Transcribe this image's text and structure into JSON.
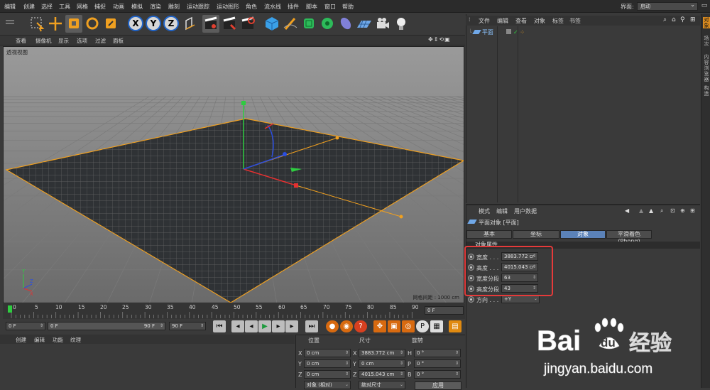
{
  "menu": {
    "items": [
      "编辑",
      "创建",
      "选择",
      "工具",
      "网格",
      "捕捉",
      "动画",
      "模拟",
      "渲染",
      "雕刻",
      "运动跟踪",
      "运动图形",
      "角色",
      "流水线",
      "插件",
      "脚本",
      "窗口",
      "帮助"
    ],
    "layout_label": "界面:",
    "layout_value": "启动"
  },
  "toolbar": {
    "axis_x": "X",
    "axis_y": "Y",
    "axis_z": "Z",
    "icons": [
      "undo-icon",
      "select-live-icon",
      "move-icon",
      "scale-icon",
      "rotate-icon",
      "recent-tool-icon",
      "axis-x-icon",
      "axis-y-icon",
      "axis-z-icon",
      "coord-system-icon",
      "render-view-icon",
      "render-picture-viewer-icon",
      "render-settings-icon",
      "cube-icon",
      "pen-icon",
      "subdivision-icon",
      "mograph-icon",
      "deformer-icon",
      "floor-icon",
      "camera-icon",
      "light-icon"
    ]
  },
  "viewport": {
    "menu": [
      "查看",
      "摄像机",
      "显示",
      "选项",
      "过滤",
      "面板"
    ],
    "title": "透视视图",
    "grid_spacing": "网格间距 : 1000 cm",
    "nav_glyphs": "✥⇕⟲▣",
    "axis_y": "Y",
    "axis_z": "Z",
    "axis_x": "X"
  },
  "timeline": {
    "ticks": [
      "0",
      "5",
      "10",
      "15",
      "20",
      "25",
      "30",
      "35",
      "40",
      "45",
      "50",
      "55",
      "60",
      "65",
      "70",
      "75",
      "80",
      "85",
      "90"
    ],
    "current_frame": "0 F"
  },
  "transport": {
    "start_field": "0 F",
    "range_start": "0 F",
    "range_end": "90 F",
    "end_field": "90 F",
    "buttons": [
      "⏮",
      "◂",
      "▶",
      "▸",
      "⏭"
    ]
  },
  "materials": {
    "menu": [
      "创建",
      "编辑",
      "功能",
      "纹理"
    ]
  },
  "coordinates": {
    "head_position": "位置",
    "head_size": "尺寸",
    "head_rotation": "旋转",
    "rows": [
      {
        "axis": "X",
        "pos": "0 cm",
        "size_axis": "X",
        "size": "3883.772 cm",
        "rot_axis": "H",
        "rot": "0 °"
      },
      {
        "axis": "Y",
        "pos": "0 cm",
        "size_axis": "Y",
        "size": "0 cm",
        "rot_axis": "P",
        "rot": "0 °"
      },
      {
        "axis": "Z",
        "pos": "0 cm",
        "size_axis": "Z",
        "size": "4015.043 cm",
        "rot_axis": "B",
        "rot": "0 °"
      }
    ],
    "mode_select": "对象 (相对)",
    "size_select": "绝对尺寸",
    "apply": "应用"
  },
  "object_manager": {
    "menu": [
      "文件",
      "编辑",
      "查看",
      "对象",
      "标签",
      "书签"
    ],
    "object_name": "平面",
    "check_glyph": "✓"
  },
  "right_tabs": [
    "对象",
    "场次",
    "内容浏览器",
    "构造"
  ],
  "attribute_manager": {
    "menu": [
      "模式",
      "编辑",
      "用户数据"
    ],
    "title": "平面对象 [平面]",
    "tabs": [
      "基本",
      "坐标",
      "对象",
      "平滑着色(Phong)"
    ],
    "active_tab": "对象",
    "section": "对象属性",
    "props": [
      {
        "label": "宽度 . . .",
        "value": "3883.772 cr"
      },
      {
        "label": "高度 . . .",
        "value": "4015.043 cr"
      },
      {
        "label": "宽度分段",
        "value": "63"
      },
      {
        "label": "高度分段",
        "value": "43"
      },
      {
        "label": "方向 . . .",
        "value": "+Y"
      }
    ]
  },
  "watermark": {
    "brand_left": "Bai",
    "brand_right": "du",
    "brand_cn": "经验",
    "url": "jingyan.baidu.com"
  },
  "colors": {
    "accent_blue": "#1f63c8",
    "selection_orange": "#f0a020",
    "highlight_red": "#e53a3a",
    "tab_active": "#5b82b8"
  }
}
